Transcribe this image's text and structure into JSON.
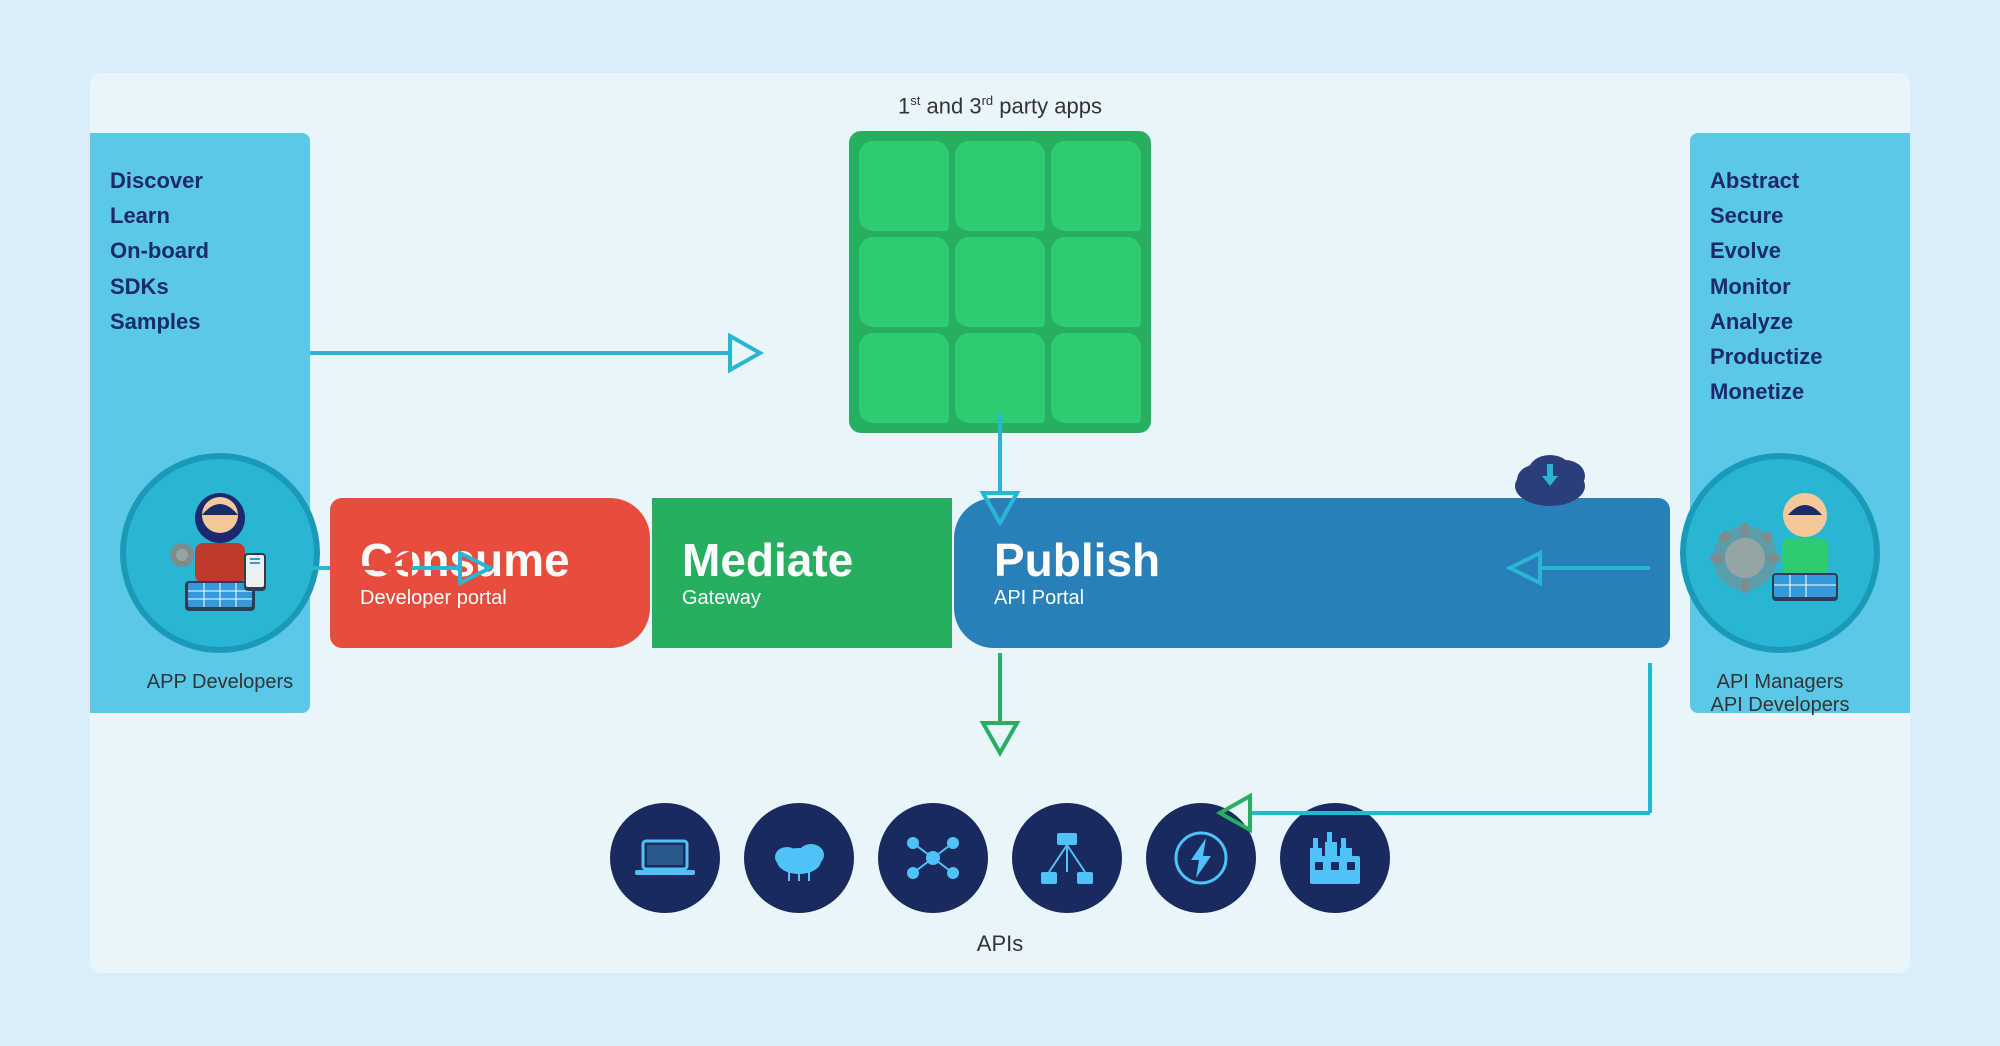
{
  "diagram": {
    "background_color": "#daeef7",
    "inner_bg": "#e8f6fc"
  },
  "left_panel": {
    "items": [
      "Discover",
      "Learn",
      "On-board",
      "SDKs",
      "Samples"
    ]
  },
  "right_panel": {
    "items": [
      "Abstract",
      "Secure",
      "Evolve",
      "Monitor",
      "Analyze",
      "Productize",
      "Monetize"
    ]
  },
  "apps_section": {
    "label": "1",
    "label_suffix": "st",
    "label_middle": " and 3",
    "label_end": "rd",
    "label_last": " party apps"
  },
  "consume": {
    "main": "Consume",
    "sub": "Developer portal"
  },
  "mediate": {
    "main": "Mediate",
    "sub": "Gateway"
  },
  "publish": {
    "main": "Publish",
    "sub": "API Portal"
  },
  "person_left": {
    "label": "APP Developers"
  },
  "person_right": {
    "label_line1": "API Managers",
    "label_line2": "API Developers"
  },
  "apis_label": "APIs"
}
